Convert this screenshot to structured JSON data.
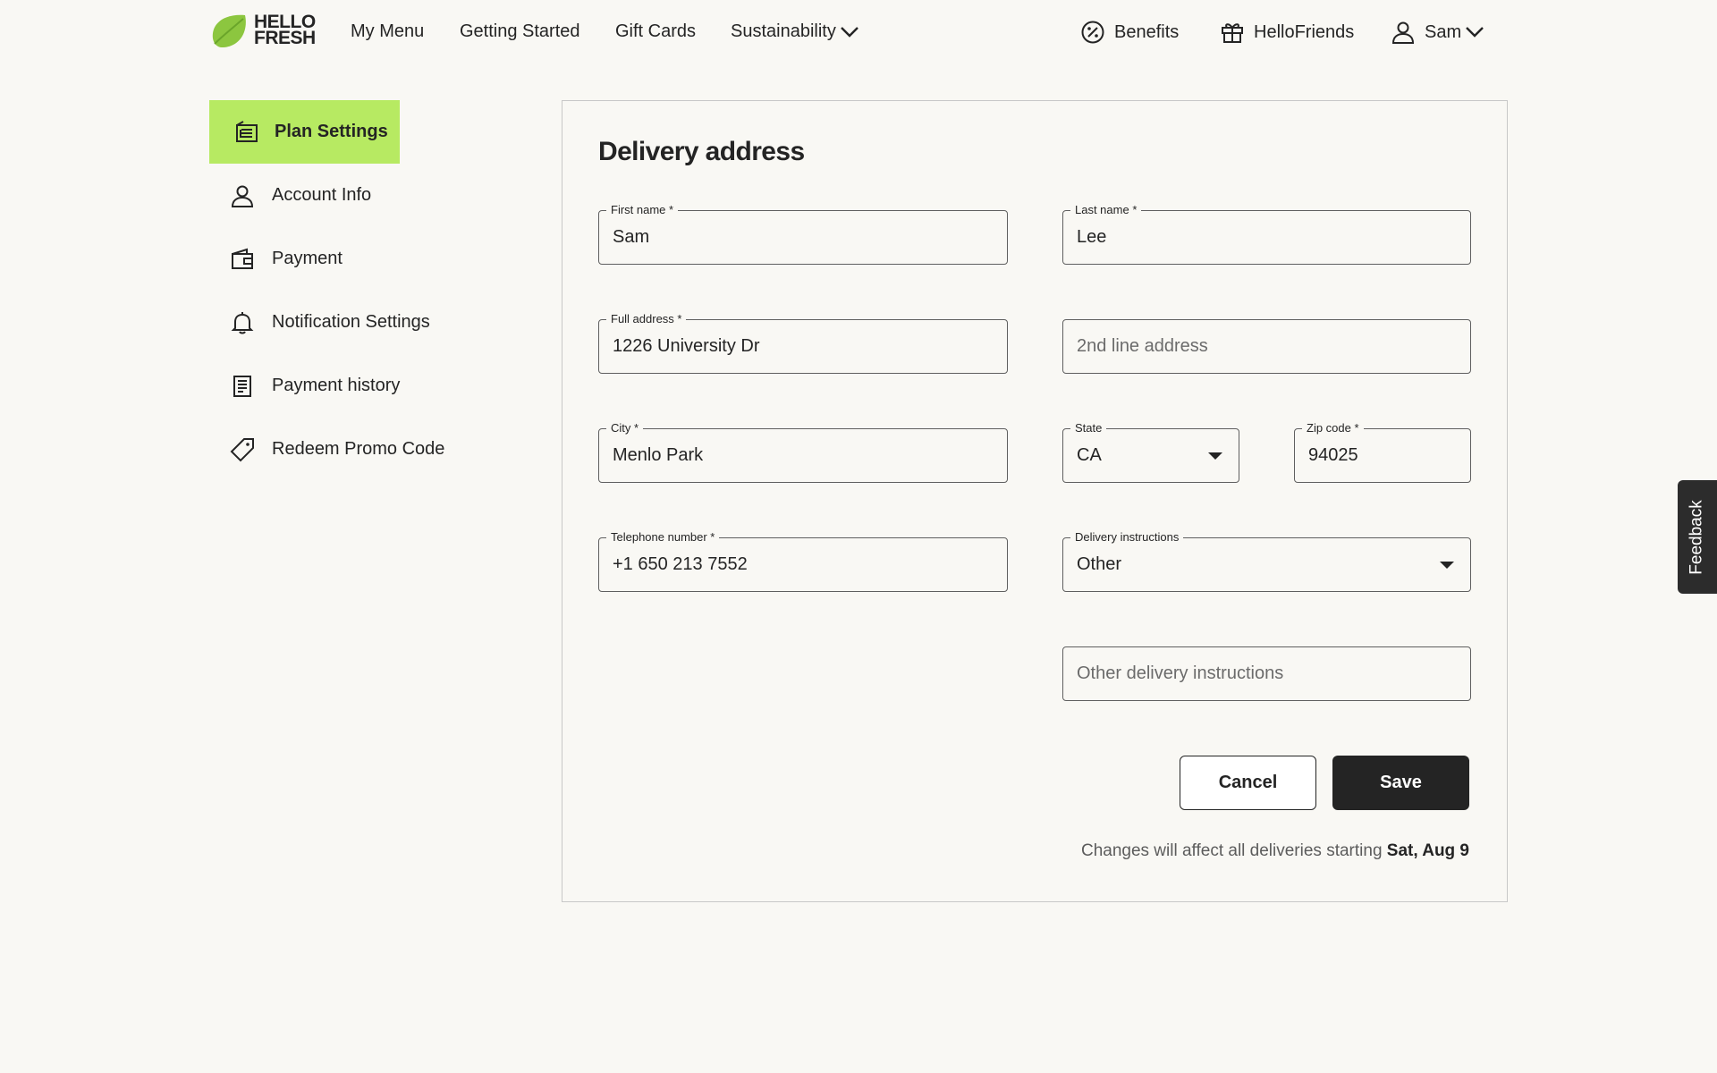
{
  "brand": {
    "logo_line1": "HELLO",
    "logo_line2": "FRESH",
    "accent": "#b7ea62",
    "logo_green": "#8cc63f"
  },
  "header": {
    "nav": [
      "My Menu",
      "Getting Started",
      "Gift Cards",
      "Sustainability"
    ],
    "benefits": "Benefits",
    "hellofriends": "HelloFriends",
    "user": "Sam"
  },
  "sidebar": {
    "items": [
      {
        "label": "Plan Settings",
        "icon": "plan-settings-icon"
      },
      {
        "label": "Account Info",
        "icon": "person-icon"
      },
      {
        "label": "Payment",
        "icon": "wallet-icon"
      },
      {
        "label": "Notification Settings",
        "icon": "bell-icon"
      },
      {
        "label": "Payment history",
        "icon": "receipt-icon"
      },
      {
        "label": "Redeem Promo Code",
        "icon": "tag-icon"
      }
    ]
  },
  "form": {
    "title": "Delivery address",
    "first_name": {
      "label": "First name *",
      "value": "Sam"
    },
    "last_name": {
      "label": "Last name *",
      "value": "Lee"
    },
    "full_address": {
      "label": "Full address *",
      "value": "1226 University Dr"
    },
    "address_line2": {
      "placeholder": "2nd line address"
    },
    "city": {
      "label": "City *",
      "value": "Menlo Park"
    },
    "state": {
      "label": "State",
      "value": "CA"
    },
    "zip": {
      "label": "Zip code *",
      "value": "94025"
    },
    "telephone": {
      "label": "Telephone number *",
      "value": "+1 650 213 7552"
    },
    "delivery_instructions": {
      "label": "Delivery instructions",
      "value": "Other"
    },
    "other_instructions": {
      "placeholder": "Other delivery instructions"
    },
    "cancel": "Cancel",
    "save": "Save",
    "note_prefix": "Changes will affect all deliveries starting ",
    "note_date": "Sat, Aug 9"
  },
  "feedback": "Feedback"
}
